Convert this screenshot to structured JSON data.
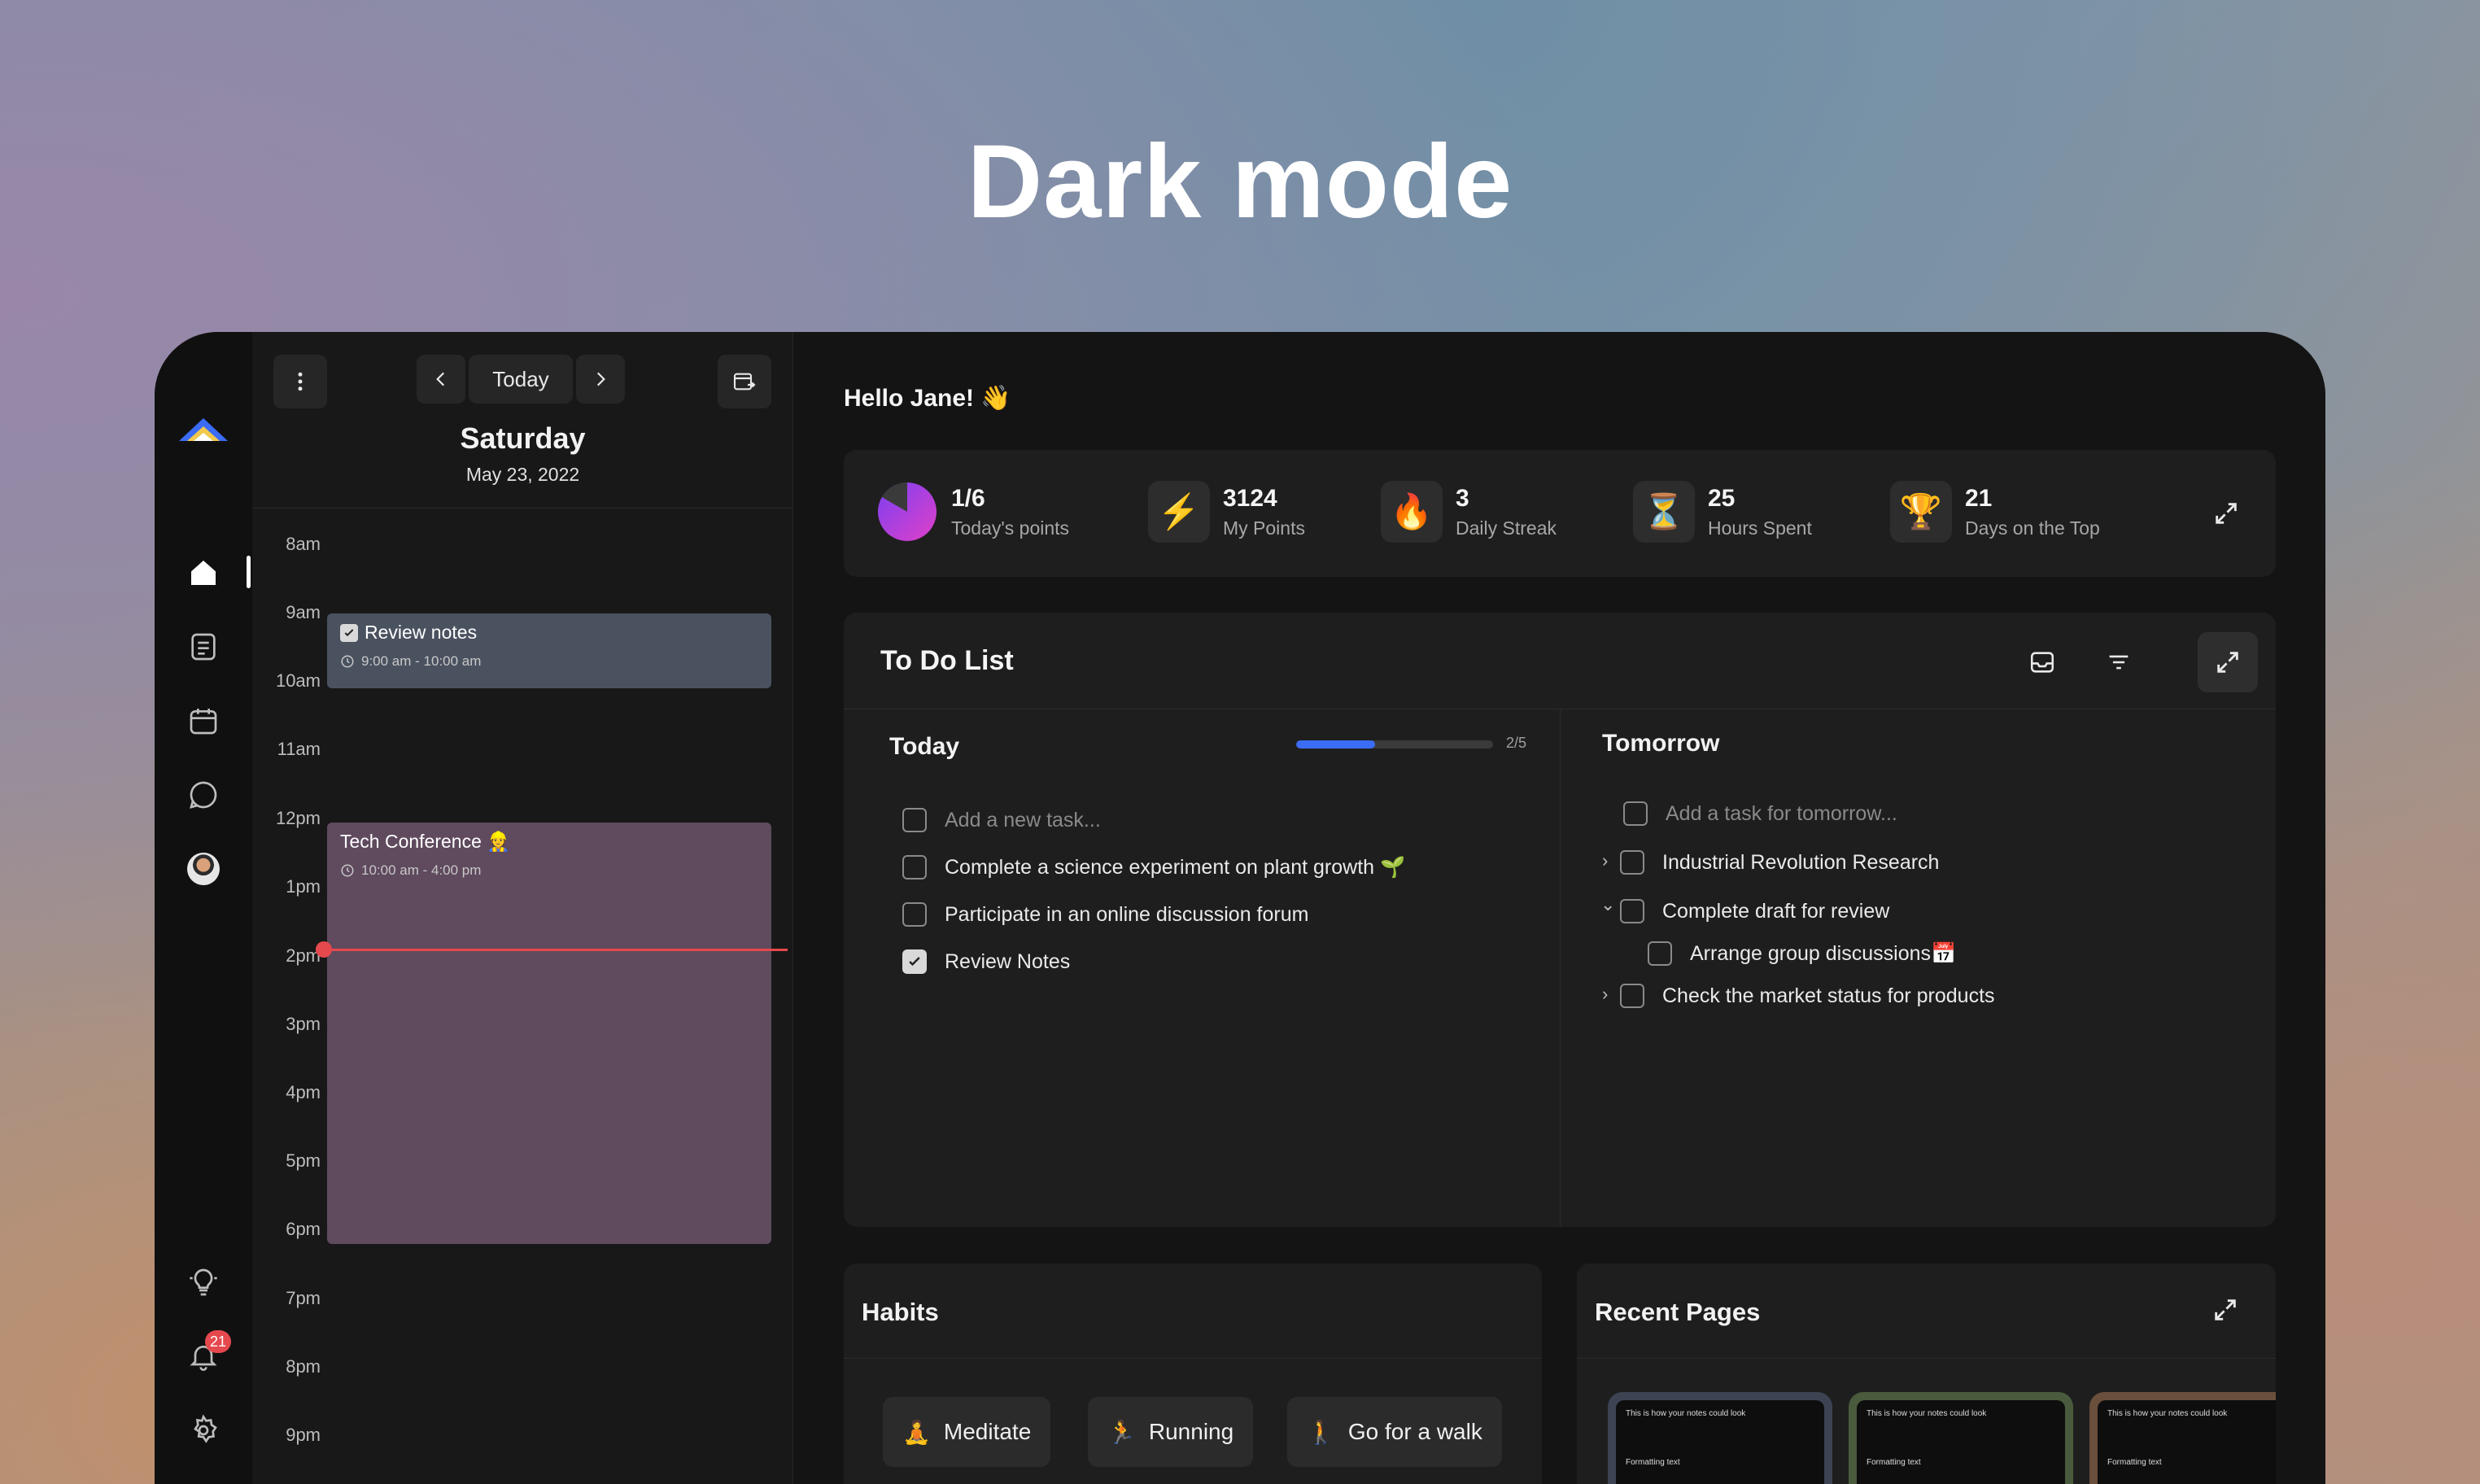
{
  "hero_title": "Dark mode",
  "calendar": {
    "nav_today_label": "Today",
    "day_name": "Saturday",
    "date": "May 23, 2022",
    "hours": [
      "8am",
      "9am",
      "10am",
      "11am",
      "12pm",
      "1pm",
      "2pm",
      "3pm",
      "4pm",
      "5pm",
      "6pm",
      "7pm",
      "8pm",
      "9pm"
    ],
    "events": [
      {
        "title": "Review notes",
        "time": "9:00 am - 10:00 am",
        "color": "#4a5260"
      },
      {
        "title": "Tech Conference 👷",
        "time": "10:00 am - 4:00 pm",
        "color": "#5f4a5e"
      }
    ]
  },
  "rail": {
    "notification_count": "21"
  },
  "main": {
    "greeting": "Hello Jane! 👋",
    "stats": [
      {
        "value": "1/6",
        "label": "Today's points",
        "icon": "pie-chart-icon"
      },
      {
        "value": "3124",
        "label": "My Points",
        "icon": "lightning-icon",
        "glyph": "⚡"
      },
      {
        "value": "3",
        "label": "Daily Streak",
        "icon": "fire-icon",
        "glyph": "🔥"
      },
      {
        "value": "25",
        "label": "Hours Spent",
        "icon": "hourglass-icon",
        "glyph": "⏳"
      },
      {
        "value": "21",
        "label": "Days on the Top",
        "icon": "trophy-icon",
        "glyph": "🏆"
      }
    ],
    "todo": {
      "title": "To Do List",
      "today": {
        "title": "Today",
        "progress_text": "2/5",
        "progress_fraction": 0.4,
        "placeholder": "Add a new task...",
        "tasks": [
          {
            "label": "Complete a science experiment on plant growth 🌱",
            "done": false
          },
          {
            "label": "Participate in an online discussion forum",
            "done": false
          },
          {
            "label": "Review Notes",
            "done": true
          }
        ]
      },
      "tomorrow": {
        "title": "Tomorrow",
        "placeholder": "Add a task for tomorrow...",
        "tasks": [
          {
            "label": "Industrial Revolution Research",
            "caret": "›"
          },
          {
            "label": "Complete draft for review",
            "caret": "⌄"
          },
          {
            "label": "Arrange group discussions📅",
            "caret": ""
          },
          {
            "label": "Check the market status for products",
            "caret": "›"
          }
        ]
      }
    },
    "habits": {
      "title": "Habits",
      "items": [
        {
          "label": "Meditate",
          "glyph": "🧘"
        },
        {
          "label": "Running",
          "glyph": "🏃"
        },
        {
          "label": "Go for a walk",
          "glyph": "🚶"
        }
      ]
    },
    "recent_pages": {
      "title": "Recent Pages",
      "thumbs": [
        {
          "heading": "This is how your notes could look",
          "line1": "Formatting text",
          "border": "#3c4352"
        },
        {
          "heading": "This is how your notes could look",
          "line1": "Formatting text",
          "border": "#4a5a3c"
        },
        {
          "heading": "This is how your notes could look",
          "line1": "Formatting text",
          "border": "#6a4f3c"
        }
      ]
    }
  }
}
